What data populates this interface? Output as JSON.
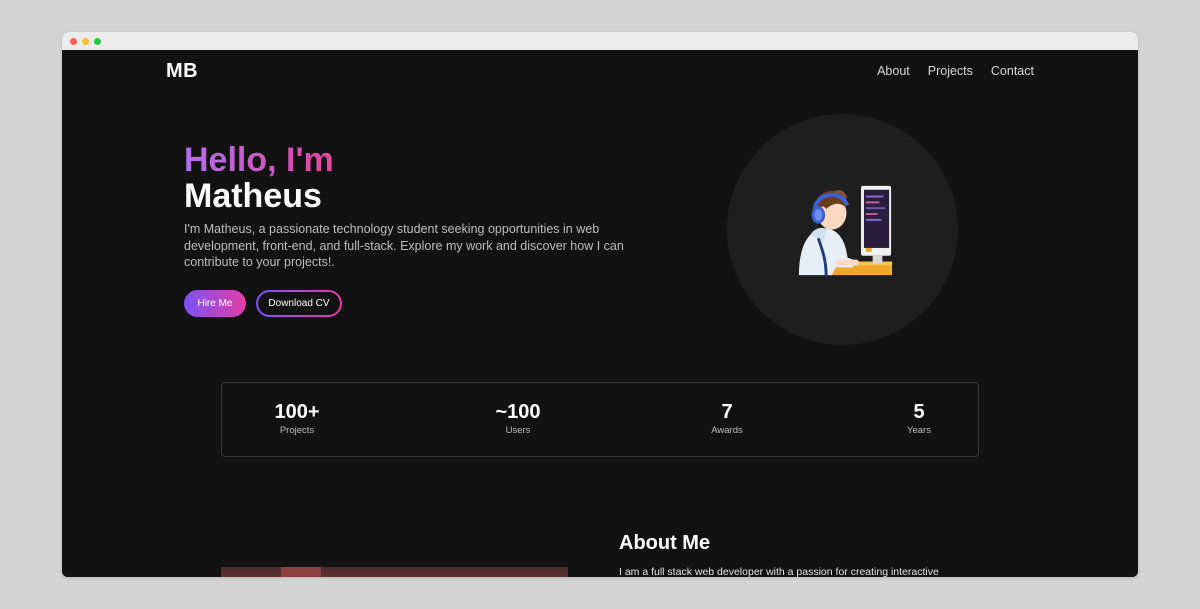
{
  "header": {
    "logo": "MB",
    "nav": [
      "About",
      "Projects",
      "Contact"
    ]
  },
  "hero": {
    "greeting": "Hello, I'm",
    "name": "Matheus",
    "description": "I'm Matheus, a passionate technology student seeking opportunities in web development, front-end, and full-stack. Explore my work and discover how I can contribute to your projects!.",
    "hire_label": "Hire Me",
    "cv_label": "Download CV"
  },
  "stats": [
    {
      "value": "100+",
      "label": "Projects"
    },
    {
      "value": "~100",
      "label": "Users"
    },
    {
      "value": "7",
      "label": "Awards"
    },
    {
      "value": "5",
      "label": "Years"
    }
  ],
  "about": {
    "title": "About Me",
    "text": "I am a full stack web developer with a passion for creating interactive"
  },
  "colors": {
    "background": "#121212",
    "gradient_start": "#7b52f4",
    "gradient_end": "#e23ea6"
  }
}
